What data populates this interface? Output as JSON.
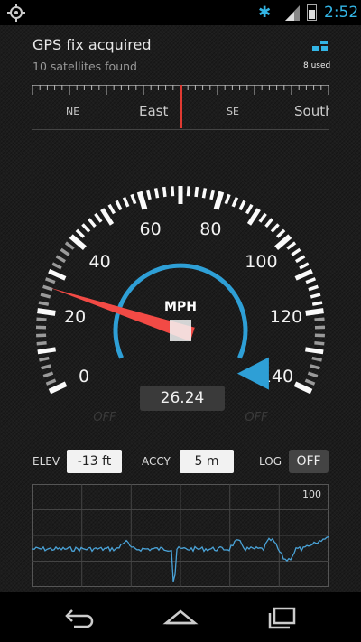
{
  "status_bar": {
    "time": "2:52",
    "icons": [
      "gps-icon",
      "bluetooth-icon",
      "signal-icon",
      "battery-icon"
    ],
    "accent": "#33b5e5"
  },
  "fix": {
    "title": "GPS fix acquired",
    "subtitle": "10 satellites found",
    "satellites_used": "8 used"
  },
  "compass": {
    "labels": [
      "NE",
      "East",
      "SE",
      "South"
    ]
  },
  "speedometer": {
    "unit": "MPH",
    "scale_labels": [
      "0",
      "20",
      "40",
      "60",
      "80",
      "100",
      "120",
      "140"
    ],
    "speed": "26.24",
    "left_indicator": "OFF",
    "right_indicator": "OFF",
    "needle_color": "#f24a45",
    "arc_color": "#2e9fd6"
  },
  "controls": {
    "elev_label": "ELEV",
    "elev_value": "-13 ft",
    "accy_label": "ACCY",
    "accy_value": "5 m",
    "log_label": "LOG",
    "log_value": "OFF"
  },
  "graph": {
    "max_label": "100",
    "line_color": "#4aa3d8"
  },
  "nav": {
    "buttons": [
      "back-icon",
      "home-icon",
      "recent-apps-icon"
    ]
  }
}
